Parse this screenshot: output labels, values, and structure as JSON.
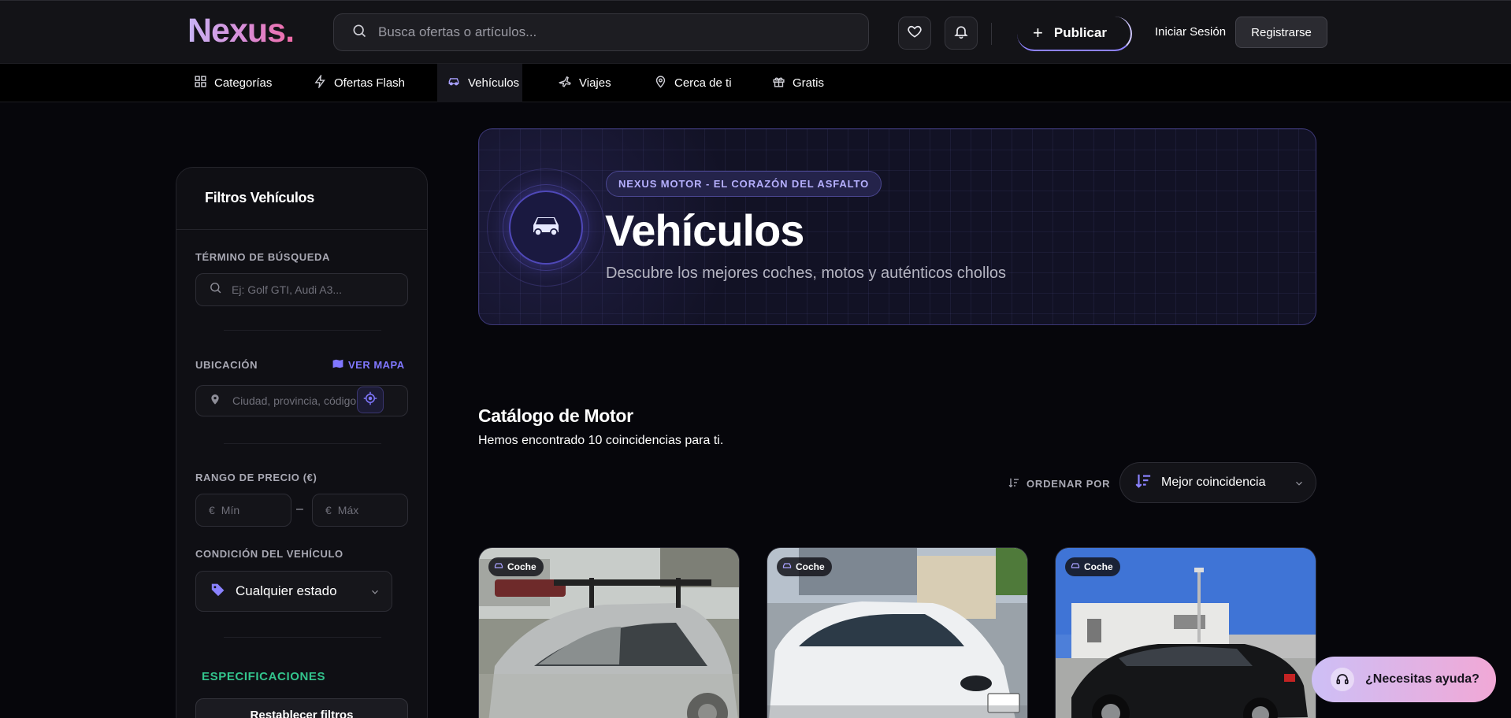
{
  "header": {
    "logo": "Nexus.",
    "search_placeholder": "Busca ofertas o artículos...",
    "publish_label": "Publicar",
    "login_label": "Iniciar Sesión",
    "register_label": "Registrarse"
  },
  "nav": {
    "items": [
      {
        "label": "Categorías",
        "icon": "grid-icon"
      },
      {
        "label": "Ofertas Flash",
        "icon": "lightning-icon"
      },
      {
        "label": "Vehículos",
        "icon": "car-icon",
        "active": true
      },
      {
        "label": "Viajes",
        "icon": "plane-icon"
      },
      {
        "label": "Cerca de ti",
        "icon": "map-pin-icon"
      },
      {
        "label": "Gratis",
        "icon": "gift-icon"
      }
    ]
  },
  "sidebar": {
    "title": "Filtros Vehículos",
    "search_label": "TÉRMINO DE BÚSQUEDA",
    "search_placeholder": "Ej: Golf GTI, Audi A3...",
    "location_label": "UBICACIÓN",
    "map_link": "VER MAPA",
    "location_placeholder": "Ciudad, provincia, código p",
    "price_label": "RANGO DE PRECIO (€)",
    "currency_symbol": "€",
    "price_separator": "–",
    "price_min_placeholder": "Mín",
    "price_max_placeholder": "Máx",
    "condition_label": "CONDICIÓN DEL VEHÍCULO",
    "condition_value": "Cualquier estado",
    "specs_label": "ESPECIFICACIONES",
    "reset_label": "Restablecer filtros"
  },
  "hero": {
    "badge": "NEXUS MOTOR - EL CORAZÓN DEL ASFALTO",
    "title": "Vehículos",
    "subtitle": "Descubre los mejores coches, motos y auténticos chollos"
  },
  "catalog": {
    "title": "Catálogo de Motor",
    "subtitle": "Hemos encontrado 10 coincidencias para ti.",
    "sort_label": "ORDENAR POR",
    "sort_value": "Mejor coincidencia",
    "cards": [
      {
        "tag": "Coche"
      },
      {
        "tag": "Coche"
      },
      {
        "tag": "Coche"
      }
    ]
  },
  "help": {
    "label": "¿Necesitas ayuda?"
  },
  "colors": {
    "accent": "#8077ff",
    "spec_green": "#33c48d",
    "background": "#06060b"
  }
}
